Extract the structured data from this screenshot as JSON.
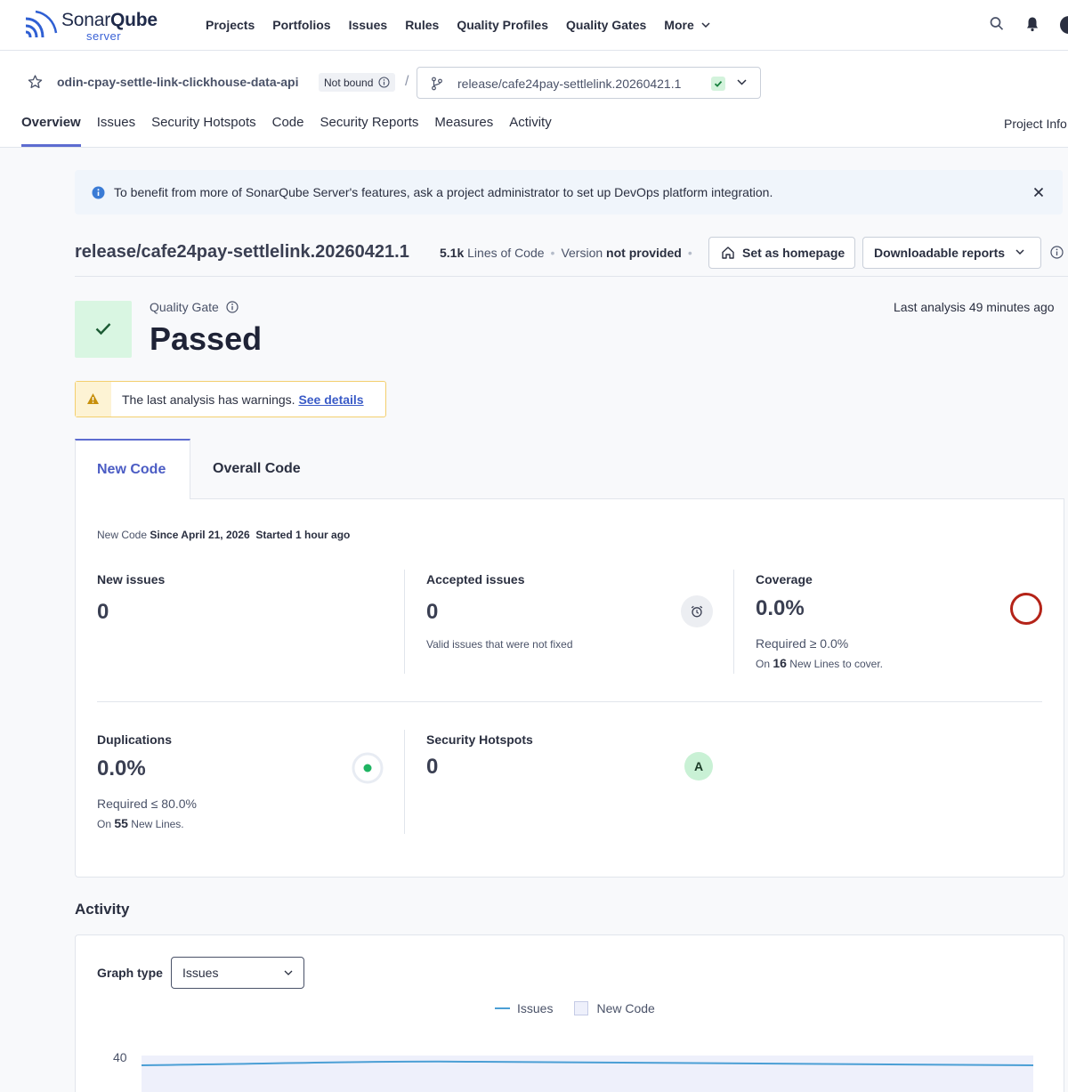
{
  "logo": {
    "brand_a": "Sonar",
    "brand_b": "Qube",
    "sub": "server"
  },
  "nav": {
    "items": [
      "Projects",
      "Portfolios",
      "Issues",
      "Rules",
      "Quality Profiles",
      "Quality Gates",
      "More"
    ],
    "icons": [
      "search-icon",
      "bell-icon",
      "avatar"
    ]
  },
  "project": {
    "name": "odin-cpay-settle-link-clickhouse-data-api",
    "binding": "Not bound",
    "separator": "/",
    "branch": "release/cafe24pay-settlelink.20260421.1",
    "tabs": [
      "Overview",
      "Issues",
      "Security Hotspots",
      "Code",
      "Security Reports",
      "Measures",
      "Activity"
    ],
    "active_tab": "Overview",
    "project_info": "Project Info"
  },
  "banner": {
    "text": "To benefit from more of SonarQube Server's features, ask a project administrator to set up DevOps platform integration."
  },
  "branch_header": {
    "title": "release/cafe24pay-settlelink.20260421.1",
    "loc_value": "5.1k",
    "loc_label": "Lines of Code",
    "version_label": "Version",
    "version_value": "not provided",
    "homepage_button": "Set as homepage",
    "reports_button": "Downloadable reports"
  },
  "quality_gate": {
    "label": "Quality Gate",
    "status": "Passed",
    "last_analysis": "Last analysis 49 minutes ago"
  },
  "warning": {
    "text": "The last analysis has warnings.",
    "link": "See details"
  },
  "code_tabs": {
    "new": "New Code",
    "overall": "Overall Code"
  },
  "new_code": {
    "prefix": "New Code",
    "since": "Since April 21, 2026",
    "started": "Started 1 hour ago"
  },
  "metrics": {
    "new_issues": {
      "label": "New issues",
      "value": "0"
    },
    "accepted_issues": {
      "label": "Accepted issues",
      "value": "0",
      "sub": "Valid issues that were not fixed"
    },
    "coverage": {
      "label": "Coverage",
      "value": "0.0%",
      "required": "Required ≥ 0.0%",
      "on": "On",
      "lines": "16",
      "lines_label": "New Lines to cover."
    },
    "duplications": {
      "label": "Duplications",
      "value": "0.0%",
      "required": "Required ≤ 80.0%",
      "on": "On",
      "lines": "55",
      "lines_label": "New Lines."
    },
    "hotspots": {
      "label": "Security Hotspots",
      "value": "0",
      "rating": "A"
    }
  },
  "activity": {
    "title": "Activity",
    "graph_type_label": "Graph type",
    "graph_type_value": "Issues",
    "legend_series": "Issues",
    "legend_new_code": "New Code",
    "y_tick": "40"
  },
  "colors": {
    "accent": "#5d6cd0",
    "passed_bg": "#d9f6e2",
    "coverage_ring": "#b42318",
    "duplication_dot": "#1fb462",
    "warning_border": "#f3cf6e",
    "chart_line": "#4b9fd5"
  }
}
